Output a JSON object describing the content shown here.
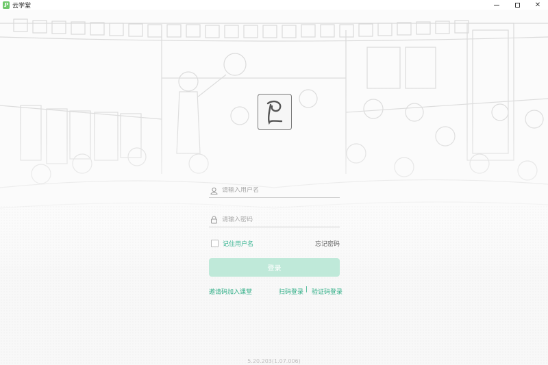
{
  "window": {
    "title": "云学堂",
    "app_icon_glyph": "P",
    "app_icon_color": "#6ec86a",
    "controls": {
      "minimize": "minimize-icon",
      "maximize": "maximize-icon",
      "close": "✕"
    }
  },
  "logo": {
    "glyph": "P"
  },
  "login": {
    "username_placeholder": "请输入用户名",
    "password_placeholder": "请输入密码",
    "remember_label": "记住用户名",
    "forgot_label": "忘记密码",
    "submit_label": "登录",
    "submit_color": "#bfe9d9",
    "accent_color": "#33b38f"
  },
  "links": {
    "invite": "邀请码加入课堂",
    "scan": "扫码登录",
    "separator": "|",
    "verify": "验证码登录"
  },
  "version": "5.20.203(1.07.006)"
}
